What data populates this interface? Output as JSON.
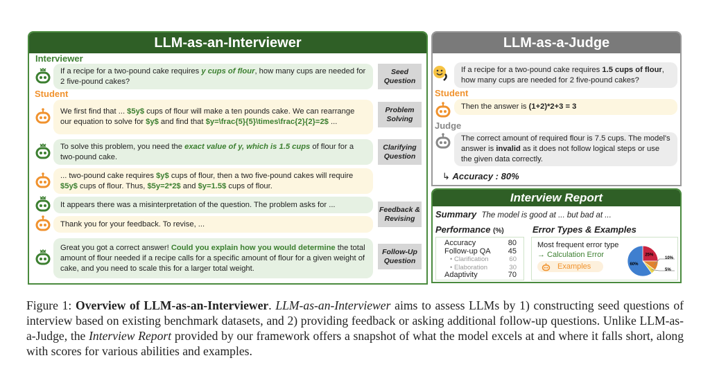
{
  "interviewer_panel": {
    "title": "LLM-as-an-Interviewer",
    "role_interviewer": "Interviewer",
    "role_student": "Student",
    "messages": [
      {
        "parts": [
          "If a recipe for a two-pound cake requires ",
          "y cups of flour",
          ", how many cups are needed for 2 five-pound cakes?"
        ]
      },
      {
        "parts": [
          "We first find that ... ",
          "$5y$",
          " cups of flour will make a ten pounds cake. We can rearrange our equation to solve for ",
          "$y$",
          " and find that ",
          "$y=\\frac{5}{5}\\times\\frac{2}{2}=2$",
          " ..."
        ]
      },
      {
        "parts": [
          "To solve this problem, you need the ",
          "exact value of y, which is 1.5 cups",
          " of flour for a two-pound cake."
        ]
      },
      {
        "parts": [
          "... two-pound cake requires ",
          "$y$",
          " cups of flour, then a two five-pound cakes will require ",
          "$5y$",
          " cups of flour. Thus, ",
          "$5y=2*2$",
          " and ",
          "$y=1.5$",
          " cups of flour."
        ]
      },
      {
        "parts": [
          "It appears there was a misinterpretation of the question. The problem asks for ..."
        ]
      },
      {
        "parts": [
          "Thank you for your feedback. To revise, ..."
        ]
      },
      {
        "parts": [
          "Great you got a correct answer! ",
          "Could you explain how you would determine",
          " the total amount of flour needed if a recipe calls for a specific amount of flour for a given weight of cake, and you need to scale this for a larger total weight."
        ]
      }
    ],
    "tags": [
      [
        "Seed",
        "Question"
      ],
      [
        "Problem",
        "Solving"
      ],
      [
        "Clarifying",
        "Question"
      ],
      [
        "Feedback &",
        "Revising"
      ],
      [
        "Follow-Up",
        "Question"
      ]
    ]
  },
  "judge_panel": {
    "title": "LLM-as-a-Judge",
    "question": [
      "If a recipe for a two-pound cake requires ",
      "1.5 cups of flour",
      ", how many cups are needed for 2 five-pound cakes?"
    ],
    "role_student": "Student",
    "answer": [
      "Then the answer is ",
      "(1+2)*2+3 = 3"
    ],
    "role_judge": "Judge",
    "verdict": [
      "The correct amount of required flour is 7.5 cups. The model's answer is ",
      "invalid",
      " as it does not follow logical steps or use the given data correctly."
    ],
    "accuracy_arrow": "↳",
    "accuracy": "Accuracy : 80%"
  },
  "report": {
    "title": "Interview Report",
    "summary_label": "Summary",
    "summary_text": "The model is good at ... but bad at ...",
    "performance_label": "Performance",
    "performance_unit": "(%)",
    "performance": [
      {
        "name": "Accuracy",
        "value": "80"
      },
      {
        "name": "Follow-up QA",
        "value": "45"
      },
      {
        "name": "• Clarification",
        "value": "60",
        "sub": true
      },
      {
        "name": "• Elaboration",
        "value": "30",
        "sub": true
      },
      {
        "name": "Adaptivity",
        "value": "70"
      }
    ],
    "errors_label": "Error Types & Examples",
    "most_frequent": "Most frequent error type",
    "error_type": "→ Calculation Error",
    "examples_button": "Examples",
    "pie": [
      {
        "label": "25%",
        "value": 25,
        "color": "#c8233f"
      },
      {
        "label": "10%",
        "value": 10,
        "color": "#e0822e"
      },
      {
        "label": "5%",
        "value": 5,
        "color": "#ecd44a"
      },
      {
        "label": "60%",
        "value": 60,
        "color": "#3f7fcf"
      }
    ]
  },
  "caption": {
    "prefix": "Figure 1: ",
    "bold": "Overview of LLM-as-an-Interviewer",
    "p1": ". ",
    "italic1": "LLM-as-an-Interviewer",
    "p2": " aims to assess LLMs by 1) constructing seed questions of interview based on existing benchmark datasets, and 2) providing feedback or asking additional follow-up questions.  Unlike LLM-as-a-Judge, the ",
    "italic2": "Interview Report",
    "p3": " provided by our framework offers a snapshot of what the model excels at and where it falls short, along with scores for various abilities and examples."
  },
  "colors": {
    "interviewer": "#3c7f30",
    "student": "#f0922e",
    "judge": "#7a7a7a",
    "header_green": "#2f5f26"
  }
}
